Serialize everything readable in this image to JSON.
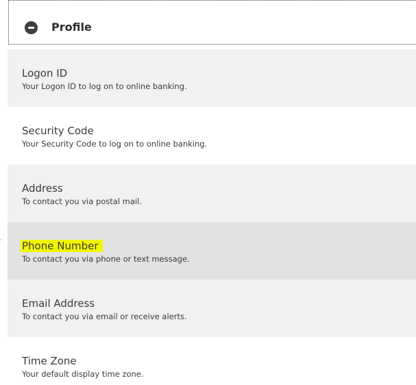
{
  "profile": {
    "title": "Profile",
    "collapse_icon": "minus-circle-icon",
    "items": [
      {
        "label": "Logon ID",
        "description": "Your Logon ID to log on to online banking."
      },
      {
        "label": "Security Code",
        "description": "Your Security Code to log on to online banking."
      },
      {
        "label": "Address",
        "description": "To contact you via postal mail."
      },
      {
        "label": "Phone Number",
        "description": "To contact you via phone or text message.",
        "highlighted": true
      },
      {
        "label": "Email Address",
        "description": "To contact you via email or receive alerts."
      },
      {
        "label": "Time Zone",
        "description": "Your default display time zone."
      }
    ]
  },
  "colors": {
    "row_odd": "#f1f1f1",
    "row_even": "#ffffff",
    "row_selected": "#e2e2e2",
    "highlight": "#f2f700",
    "text": "#3a3a3a"
  }
}
